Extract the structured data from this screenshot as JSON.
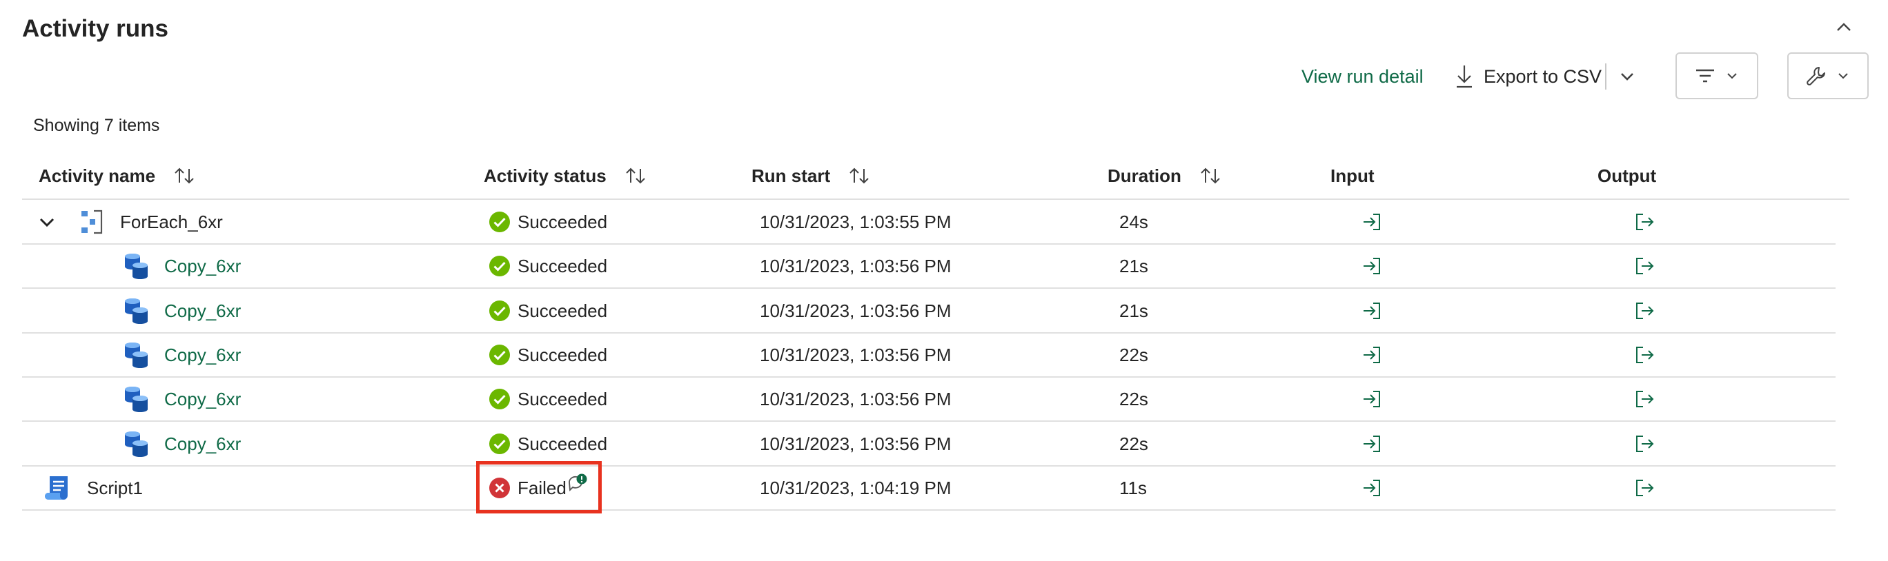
{
  "panel": {
    "title": "Activity runs",
    "collapse_icon": "chevron-up-icon"
  },
  "toolbar": {
    "view_run_detail": "View run detail",
    "export_label": "Export to CSV",
    "export_icon": "download-icon",
    "filter_icon": "filter-icon",
    "tools_icon": "wrench-icon"
  },
  "list": {
    "count_text": "Showing 7 items",
    "columns": [
      "Activity name",
      "Activity status",
      "Run start",
      "Duration",
      "Input",
      "Output"
    ],
    "rows": [
      {
        "name": "ForEach_6xr",
        "type": "foreach",
        "status": "Succeeded",
        "run_start": "10/31/2023, 1:03:55 PM",
        "duration": "24s"
      },
      {
        "name": "Copy_6xr",
        "type": "copy",
        "status": "Succeeded",
        "run_start": "10/31/2023, 1:03:56 PM",
        "duration": "21s"
      },
      {
        "name": "Copy_6xr",
        "type": "copy",
        "status": "Succeeded",
        "run_start": "10/31/2023, 1:03:56 PM",
        "duration": "21s"
      },
      {
        "name": "Copy_6xr",
        "type": "copy",
        "status": "Succeeded",
        "run_start": "10/31/2023, 1:03:56 PM",
        "duration": "22s"
      },
      {
        "name": "Copy_6xr",
        "type": "copy",
        "status": "Succeeded",
        "run_start": "10/31/2023, 1:03:56 PM",
        "duration": "22s"
      },
      {
        "name": "Copy_6xr",
        "type": "copy",
        "status": "Succeeded",
        "run_start": "10/31/2023, 1:03:56 PM",
        "duration": "22s"
      },
      {
        "name": "Script1",
        "type": "script",
        "status": "Failed",
        "run_start": "10/31/2023, 1:04:19 PM",
        "duration": "11s"
      }
    ]
  },
  "colors": {
    "accent": "#0f6a47",
    "success": "#6bb700",
    "failed": "#d13438",
    "highlight": "#e8321f"
  }
}
